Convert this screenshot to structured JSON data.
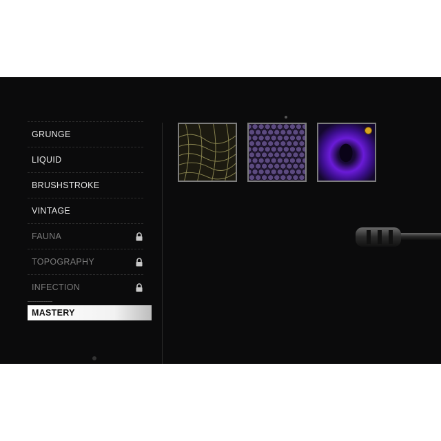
{
  "menu": {
    "items": [
      {
        "label": "GRUNGE",
        "locked": false
      },
      {
        "label": "LIQUID",
        "locked": false
      },
      {
        "label": "BRUSHSTROKE",
        "locked": false
      },
      {
        "label": "VINTAGE",
        "locked": false
      },
      {
        "label": "FAUNA",
        "locked": true
      },
      {
        "label": "TOPOGRAPHY",
        "locked": true
      },
      {
        "label": "INFECTION",
        "locked": true
      }
    ],
    "selected": {
      "label": "MASTERY"
    }
  },
  "swatches": [
    {
      "name": "snake-scale-gold",
      "colors": {
        "base": "#1c1a10",
        "line": "#8a8550"
      }
    },
    {
      "name": "purple-hex-scales",
      "colors": {
        "base": "#2a1f3a",
        "cell": "#5c4a80"
      }
    },
    {
      "name": "purple-void",
      "colors": {
        "base": "#1a0a3a",
        "glow": "#6a1bd8"
      },
      "badge": true
    }
  ],
  "colors": {
    "background": "#0b0b0c",
    "selected_bg": "#ffffff",
    "text": "#e6e6e6",
    "locked_text": "#7a7a7a"
  },
  "icons": {
    "lock": "lock-icon"
  }
}
